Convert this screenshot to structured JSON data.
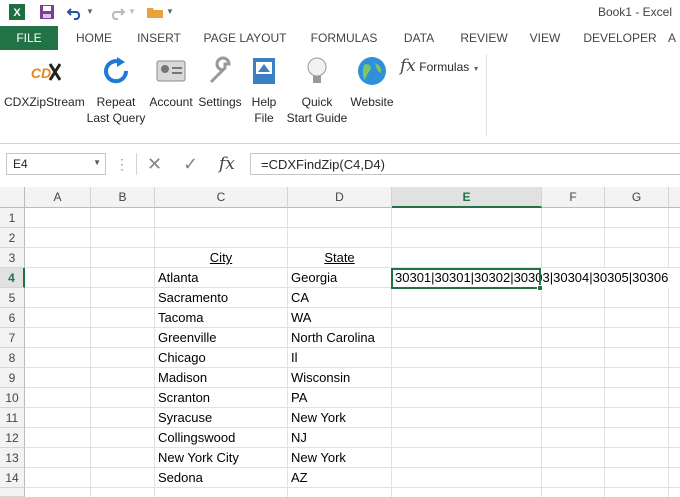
{
  "window": {
    "title": "Book1 - Excel"
  },
  "tabs": [
    "FILE",
    "HOME",
    "INSERT",
    "PAGE LAYOUT",
    "FORMULAS",
    "DATA",
    "REVIEW",
    "VIEW",
    "DEVELOPER",
    "A"
  ],
  "ribbon": {
    "cdx": "CDXZipStream",
    "repeat1": "Repeat",
    "repeat2": "Last Query",
    "account": "Account",
    "settings": "Settings",
    "help1": "Help",
    "help2": "File",
    "quick1": "Quick",
    "quick2": "Start Guide",
    "website": "Website",
    "formulas": "Formulas",
    "fx_glyph": "fx"
  },
  "formula_bar": {
    "name_box": "E4",
    "formula": "=CDXFindZip(C4,D4)",
    "fx": "fx"
  },
  "columns": [
    "A",
    "B",
    "C",
    "D",
    "E",
    "F",
    "G"
  ],
  "rows": [
    "1",
    "2",
    "3",
    "4",
    "5",
    "6",
    "7",
    "8",
    "9",
    "10",
    "11",
    "12",
    "13",
    "14"
  ],
  "headers": {
    "city": "City",
    "state": "State"
  },
  "data_rows": [
    {
      "city": "Atlanta",
      "state": "Georgia"
    },
    {
      "city": "Sacramento",
      "state": "CA"
    },
    {
      "city": "Tacoma",
      "state": "WA"
    },
    {
      "city": "Greenville",
      "state": "North Carolina"
    },
    {
      "city": "Chicago",
      "state": "Il"
    },
    {
      "city": "Madison",
      "state": "Wisconsin"
    },
    {
      "city": "Scranton",
      "state": "PA"
    },
    {
      "city": "Syracuse",
      "state": "New York"
    },
    {
      "city": "Collingswood",
      "state": "NJ"
    },
    {
      "city": "New York City",
      "state": "New York"
    },
    {
      "city": "Sedona",
      "state": "AZ"
    }
  ],
  "result_cell": "30301|30301|30302|30303|30304|30305|30306",
  "colors": {
    "accent": "#217346"
  }
}
